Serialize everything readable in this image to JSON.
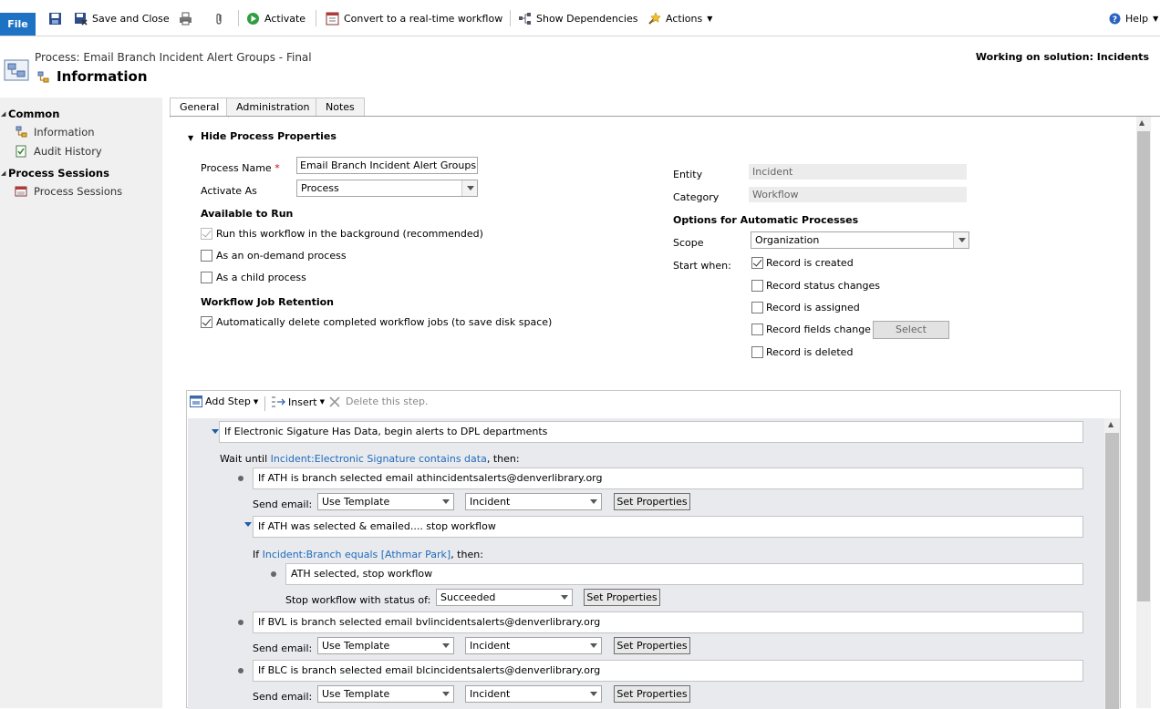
{
  "ribbon": {
    "file": "File",
    "save_close": "Save and Close",
    "activate": "Activate",
    "convert": "Convert to a real-time workflow",
    "show_deps": "Show Dependencies",
    "actions": "Actions",
    "help": "Help"
  },
  "header": {
    "subtitle": "Process: Email Branch Incident Alert Groups - Final",
    "title": "Information",
    "solution": "Working on solution: Incidents"
  },
  "nav": {
    "common": "Common",
    "information": "Information",
    "audit_history": "Audit History",
    "process_sessions_group": "Process Sessions",
    "process_sessions": "Process Sessions"
  },
  "tabs": [
    "General",
    "Administration",
    "Notes"
  ],
  "props": {
    "toggle": "Hide Process Properties",
    "process_name_label": "Process Name",
    "required_mark": "*",
    "process_name_value": "Email Branch Incident Alert Groups - F",
    "activate_as_label": "Activate As",
    "activate_as_value": "Process",
    "available_to_run": "Available to Run",
    "run_background": "Run this workflow in the background (recommended)",
    "on_demand": "As an on-demand process",
    "child_process": "As a child process",
    "job_retention": "Workflow Job Retention",
    "auto_delete": "Automatically delete completed workflow jobs (to save disk space)",
    "entity_label": "Entity",
    "entity_value": "Incident",
    "category_label": "Category",
    "category_value": "Workflow",
    "options_auto": "Options for Automatic Processes",
    "scope_label": "Scope",
    "scope_value": "Organization",
    "start_when_label": "Start when:",
    "record_created": "Record is created",
    "record_status": "Record status changes",
    "record_assigned": "Record is assigned",
    "record_fields": "Record fields change",
    "select_btn": "Select",
    "record_deleted": "Record is deleted"
  },
  "designer": {
    "add_step": "Add Step",
    "insert": "Insert",
    "delete_step": "Delete this step.",
    "step_main": "If Electronic Sigature Has Data, begin alerts to DPL departments",
    "wait_prefix": "Wait until ",
    "wait_link": "Incident:Electronic Signature contains data",
    "wait_suffix": ", then:",
    "step_ath": "If ATH is branch selected email athincidentsalerts@denverlibrary.org",
    "send_email": "Send email:",
    "use_template": "Use Template",
    "incident": "Incident",
    "set_properties": "Set Properties",
    "step_ath_stop": "If ATH was selected & emailed.... stop workflow",
    "if_prefix": "If ",
    "if_link": "Incident:Branch equals [Athmar Park]",
    "if_suffix": ", then:",
    "step_stop": "ATH selected, stop workflow",
    "stop_label": "Stop workflow with status of:",
    "succeeded": "Succeeded",
    "step_bvl": "If BVL is branch selected email bvlincidentsalerts@denverlibrary.org",
    "step_blc": "If BLC is branch selected email blcincidentsalerts@denverlibrary.org"
  }
}
